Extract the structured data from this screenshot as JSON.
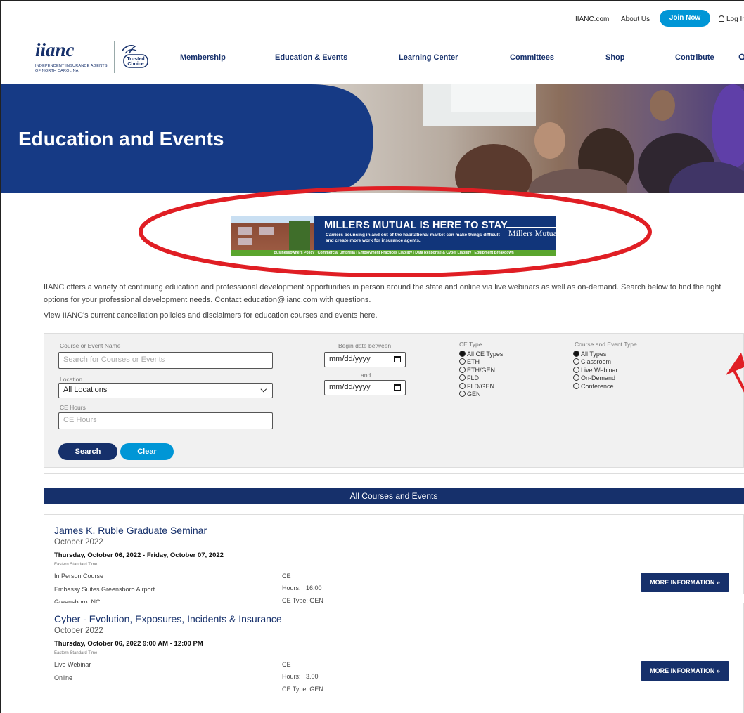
{
  "utility": {
    "links": [
      "IIANC.com",
      "About Us"
    ],
    "join_label": "Join Now",
    "login_label": "Log In"
  },
  "logo": {
    "wordmark": "iianc",
    "subtitle": "INDEPENDENT INSURANCE AGENTS OF NORTH CAROLINA",
    "partner": "Trusted Choice"
  },
  "nav": [
    "Membership",
    "Education & Events",
    "Learning Center",
    "Committees",
    "Shop",
    "Contribute"
  ],
  "hero": {
    "title": "Education and Events"
  },
  "ad": {
    "title": "MILLERS MUTUAL IS HERE TO STAY",
    "subtitle": "Carriers bouncing in and out of the habitational market can make things difficult and create more work for insurance agents.",
    "brand": "Millers Mutual",
    "strip": "Businessowners Policy | Commercial Umbrella | Employment Practices Liability | Data Response & Cyber Liability | Equipment Breakdown"
  },
  "intro": {
    "text": "IIANC offers a variety of continuing education and professional development opportunities in person around the state and online via live webinars as well as on-demand. Search below to find the right options for your professional development needs. Contact education@iianc.com with questions.",
    "policy": "View IIANC's current cancellation policies and disclaimers for education courses and events here."
  },
  "search": {
    "name_label": "Course or Event Name",
    "name_placeholder": "Search for Courses or Events",
    "location_label": "Location",
    "location_value": "All Locations",
    "hours_label": "CE Hours",
    "hours_placeholder": "CE Hours",
    "begin_label": "Begin date between",
    "and_label": "and",
    "date_placeholder": "mm/dd/yyyy",
    "ce_type_label": "CE Type",
    "ce_types": [
      "All CE Types",
      "ETH",
      "ETH/GEN",
      "FLD",
      "FLD/GEN",
      "GEN"
    ],
    "event_type_label": "Course and Event Type",
    "event_types": [
      "All Types",
      "Classroom",
      "Live Webinar",
      "On-Demand",
      "Conference"
    ],
    "search_label": "Search",
    "clear_label": "Clear"
  },
  "list": {
    "header": "All Courses and Events",
    "more_label": "MORE INFORMATION",
    "ce_label": "CE",
    "hours_prefix": "Hours:",
    "type_prefix": "CE Type:",
    "items": [
      {
        "title": "James K. Ruble Graduate Seminar",
        "month": "October 2022",
        "dates": "Thursday, October 06, 2022 - Friday, October 07, 2022",
        "tz": "Eastern Standard Time",
        "format": "In Person Course",
        "venue": "Embassy Suites Greensboro Airport",
        "city": "Greensboro, NC",
        "hours": "16.00",
        "ce_type": "GEN"
      },
      {
        "title": "Cyber - Evolution, Exposures, Incidents & Insurance",
        "month": "October 2022",
        "dates": "Thursday, October 06, 2022 9:00 AM - 12:00 PM",
        "tz": "Eastern Standard Time",
        "format": "Live Webinar",
        "venue": "Online",
        "hours": "3.00",
        "ce_type": "GEN"
      }
    ]
  },
  "colors": {
    "navy": "#16306b",
    "blue": "#0096d6",
    "annotation_red": "#e01e24"
  }
}
